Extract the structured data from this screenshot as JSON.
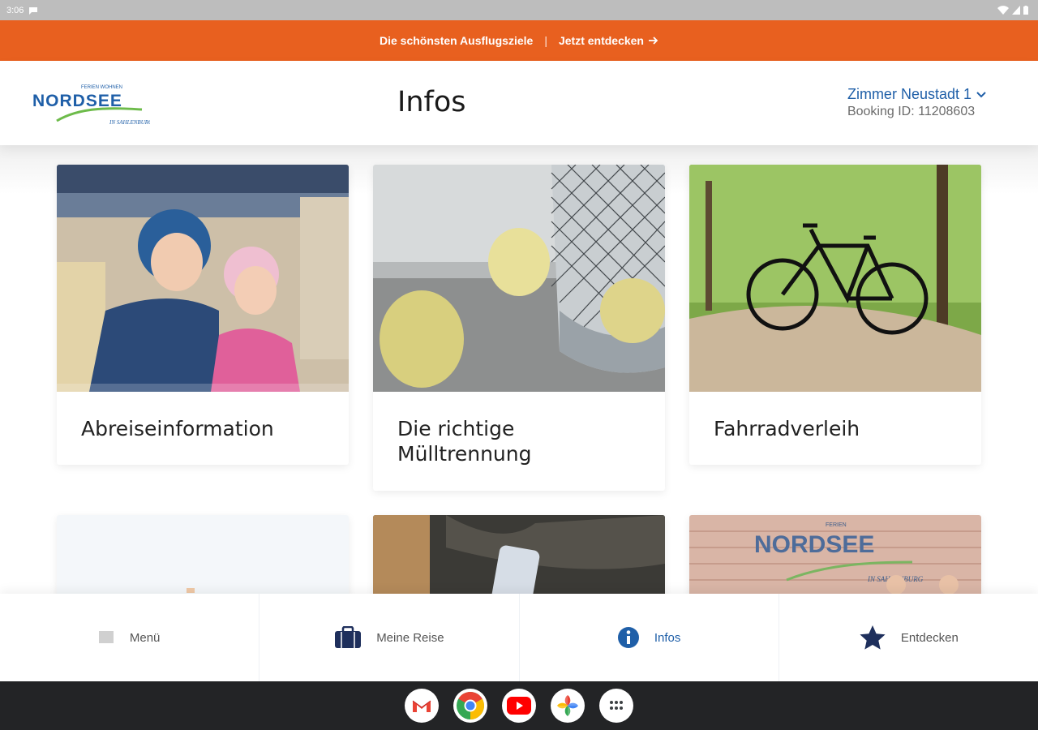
{
  "status_bar": {
    "time": "3:06"
  },
  "banner": {
    "text": "Die schönsten Ausflugsziele",
    "separator": "|",
    "link_label": "Jetzt entdecken",
    "bg_color": "#e8601f"
  },
  "header": {
    "logo": {
      "top_text": "FERIEN WOHNEN",
      "brand_text": "NORDSEE",
      "tagline": "IN SAHLENBURG"
    },
    "title": "Infos",
    "room_select": "Zimmer Neustadt 1",
    "booking_id": "Booking ID: 11208603",
    "accent_color": "#1f5fa8"
  },
  "cards": [
    {
      "label": "Abreiseinformation",
      "image": "children-in-car-trunk"
    },
    {
      "label": "Die richtige Mülltrennung",
      "image": "paper-balls-wastebasket"
    },
    {
      "label": "Fahrradverleih",
      "image": "bicycle-forest-path"
    },
    {
      "label": "",
      "image": "blank-light"
    },
    {
      "label": "",
      "image": "hand-holding-phone"
    },
    {
      "label": "",
      "image": "brick-wall-logo",
      "image_text": {
        "top": "FERIEN",
        "brand": "NORDSEE",
        "tagline": "IN SAHLENBURG"
      }
    }
  ],
  "bottom_nav": [
    {
      "label": "Menü",
      "icon": "menu-icon"
    },
    {
      "label": "Meine Reise",
      "icon": "briefcase-icon"
    },
    {
      "label": "Infos",
      "icon": "info-icon",
      "active": true
    },
    {
      "label": "Entdecken",
      "icon": "star-icon"
    }
  ],
  "dock": [
    {
      "name": "gmail-icon"
    },
    {
      "name": "chrome-icon"
    },
    {
      "name": "youtube-icon"
    },
    {
      "name": "photos-icon"
    },
    {
      "name": "app-drawer-icon"
    }
  ]
}
